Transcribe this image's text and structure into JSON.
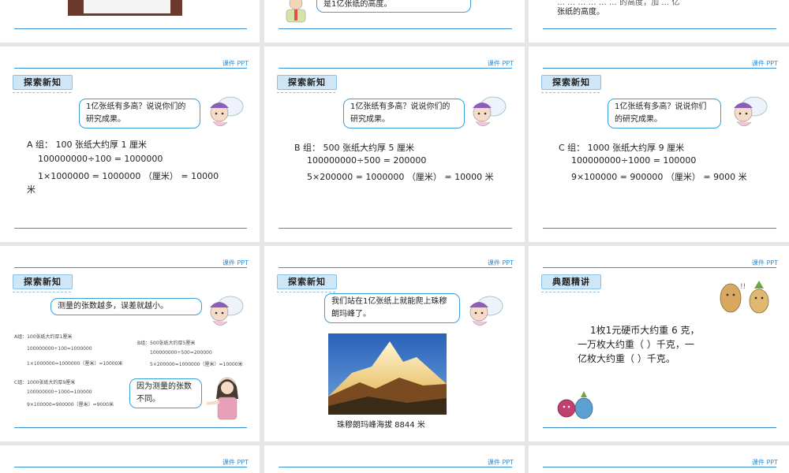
{
  "common": {
    "tag": "课件 PPT"
  },
  "row1": {
    "mid_bubble": "是1亿张纸的高度。",
    "right_text": "张纸的高度。",
    "right_partial": "… … … … … … 的高度，加 … 亿"
  },
  "headers": {
    "explore": "探索新知",
    "example": "典题精讲"
  },
  "question": "1亿张纸有多高？说说你们的研究成果。",
  "slideA": {
    "l1": "A 组： 100 张纸大约厚 1 厘米",
    "l2": "100000000÷100 = 1000000",
    "l3": "1×1000000 = 1000000 （厘米） = 10000",
    "l4": "米"
  },
  "slideB": {
    "l1": "B 组： 500 张纸大约厚 5 厘米",
    "l2": "100000000÷500 = 200000",
    "l3": "5×200000 = 1000000 （厘米） = 10000 米"
  },
  "slideC": {
    "l1": "C 组： 1000 张纸大约厚 9 厘米",
    "l2": "100000000÷1000 = 100000",
    "l3": "9×100000 = 900000 （厘米） = 9000 米"
  },
  "slideD": {
    "bubble": "测量的张数越多，误差就越小。",
    "a1": "A组：100张纸大约厚1厘米",
    "a2": "100000000÷100=1000000",
    "a3": "1×1000000=1000000（厘米）=10000米",
    "b1": "B组：500张纸大约厚5厘米",
    "b2": "100000000÷500=200000",
    "b3": "5×200000=1000000（厘米）=10000米",
    "c1": "C组：1000张纸大约厚9厘米",
    "c2": "100000000÷1000=100000",
    "c3": "9×100000=900000（厘米）=9000米",
    "girl_bubble": "因为测量的张数不同。"
  },
  "slideE": {
    "bubble": "我们站在1亿张纸上就能爬上珠穆朗玛峰了。",
    "caption": "珠穆朗玛峰海拔 8844 米"
  },
  "slideF": {
    "l1": "1枚1元硬币大约重 6 克，",
    "l2": "一万枚大约重（    ）千克，一",
    "l3": "亿枚大约重（    ）千克。"
  }
}
